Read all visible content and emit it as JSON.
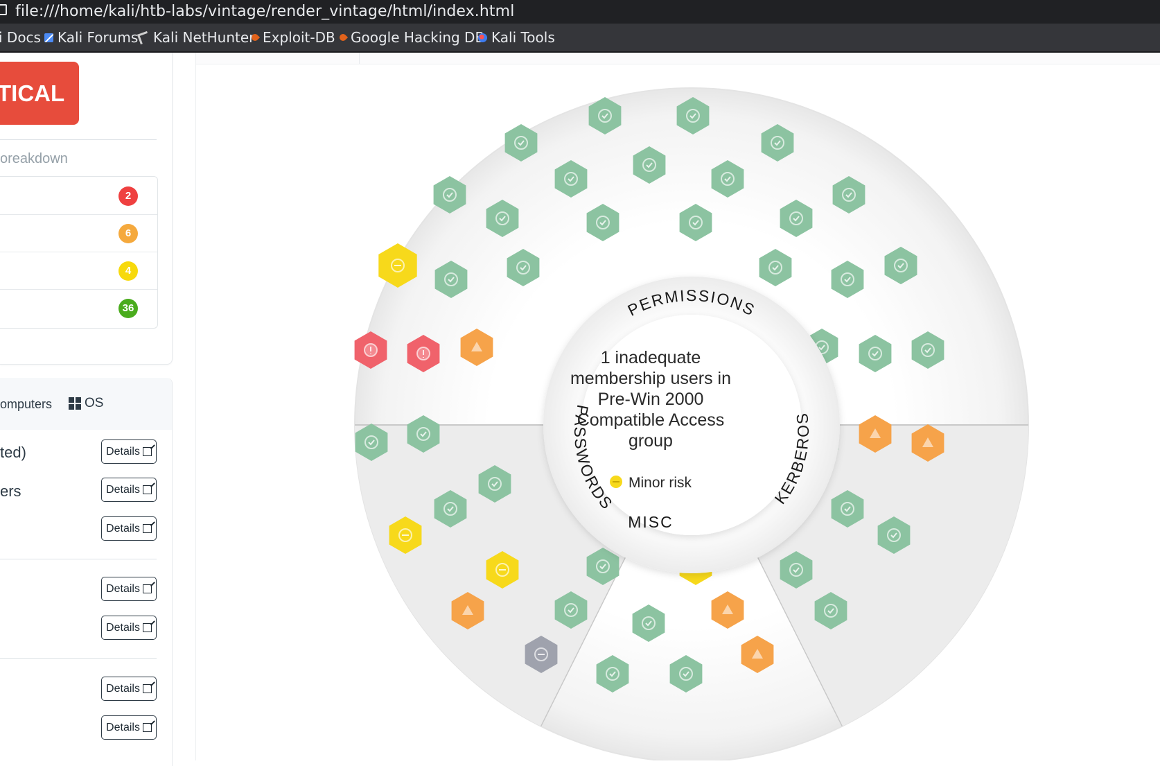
{
  "browser": {
    "url": "file:///home/kali/htb-labs/vintage/render_vintage/html/index.html",
    "bookmarks": [
      {
        "label": "i Docs",
        "icon": "kali-docs-icon"
      },
      {
        "label": "Kali Forums",
        "icon": "kali-forums-icon"
      },
      {
        "label": "Kali NetHunter",
        "icon": "nethunter-icon"
      },
      {
        "label": "Exploit-DB",
        "icon": "exploit-db-icon"
      },
      {
        "label": "Google Hacking DB",
        "icon": "ghdb-icon"
      },
      {
        "label": "Kali Tools",
        "icon": "kali-tools-icon"
      }
    ]
  },
  "sidebar": {
    "risk_level": "TICAL",
    "breakdown_title": "oreakdown",
    "breakdown": [
      {
        "count": "2",
        "color": "#ef4040"
      },
      {
        "count": "6",
        "color": "#f5a93d"
      },
      {
        "count": "4",
        "color": "#f7d90c"
      },
      {
        "count": "36",
        "color": "#4aac1d"
      }
    ],
    "tabs": {
      "computers": "omputers",
      "os": "OS"
    },
    "rows": [
      {
        "label": "ted)",
        "button": "Details"
      },
      {
        "label": "ers",
        "button": "Details"
      },
      {
        "label": "",
        "button": "Details"
      },
      {
        "label": "",
        "button": "Details"
      },
      {
        "label": "",
        "button": "Details"
      },
      {
        "label": "",
        "button": "Details"
      },
      {
        "label": "",
        "button": "Details"
      }
    ]
  },
  "radar": {
    "center_lines": [
      "1 inadequate",
      "membership users in",
      "Pre-Win 2000",
      "Compatible Access",
      "group"
    ],
    "center_legend": "Minor risk",
    "categories": {
      "permissions": "PERMISSIONS",
      "passwords": "PASSWORDS",
      "misc": "MISC",
      "kerberos": "KERBEROS"
    },
    "colors": {
      "ok": "#8cc3a1",
      "minor": "#f7d91b",
      "medium": "#f6a34a",
      "high": "#f0626b",
      "info": "#9fa2ad"
    },
    "findings": {
      "permissions": [
        "ok",
        "ok",
        "ok",
        "ok",
        "ok",
        "ok",
        "ok",
        "ok",
        "ok",
        "ok",
        "ok",
        "ok",
        "ok",
        "ok",
        "minor",
        "ok",
        "ok",
        "ok",
        "ok",
        "ok",
        "high",
        "high",
        "medium",
        "ok",
        "ok",
        "ok"
      ],
      "passwords": [
        "ok",
        "ok",
        "ok",
        "ok",
        "minor",
        "minor",
        "medium"
      ],
      "misc": [
        "ok",
        "minor",
        "ok",
        "ok",
        "medium",
        "info",
        "ok",
        "ok",
        "medium"
      ],
      "kerberos": [
        "ok",
        "medium",
        "medium",
        "ok",
        "ok",
        "ok",
        "ok",
        "ok"
      ]
    }
  }
}
